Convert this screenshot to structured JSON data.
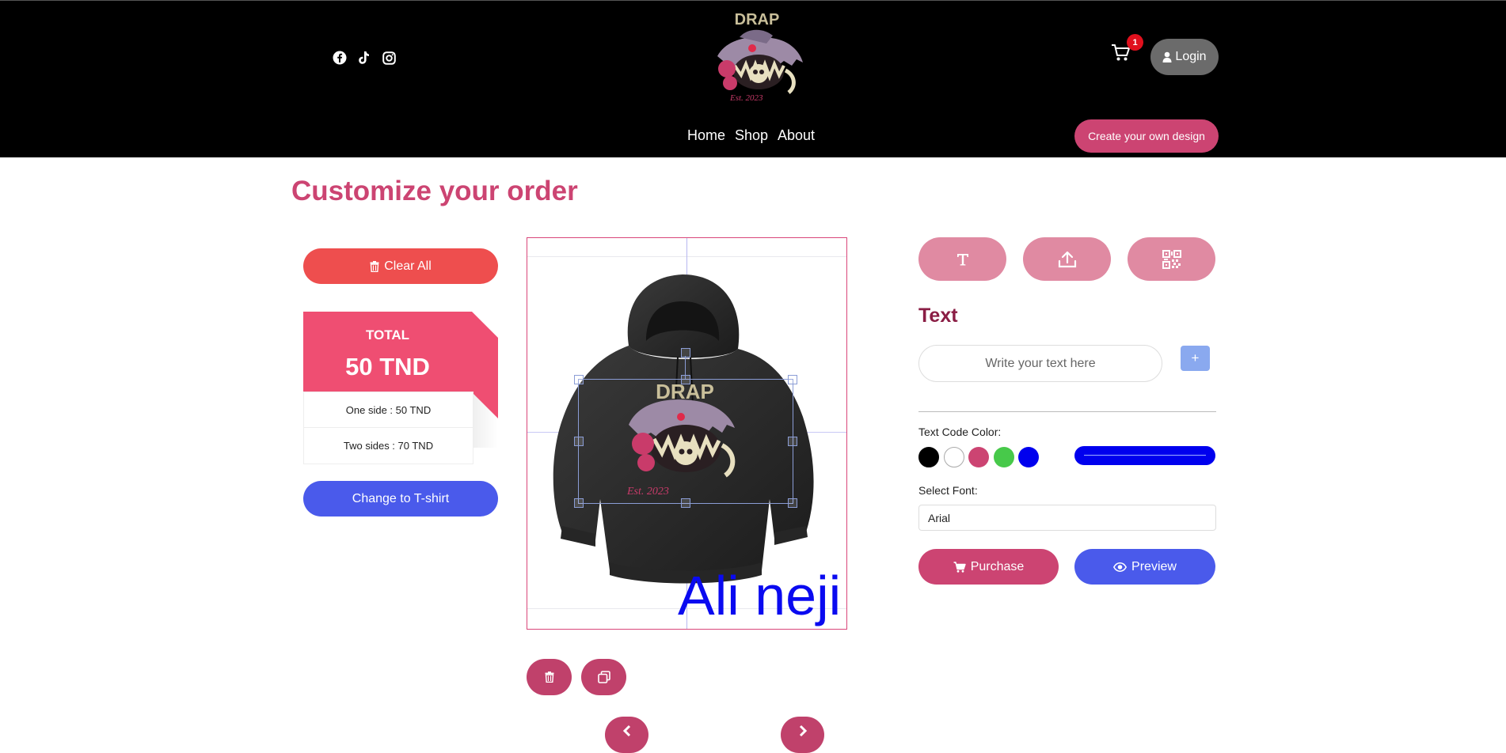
{
  "header": {
    "brand": "DRAP",
    "logo_tagline": "Est. 2023",
    "nav": [
      "Home",
      "Shop",
      "About"
    ],
    "cart_count": "1",
    "login_label": "Login",
    "create_label": "Create your own design",
    "social_icons": [
      "facebook-icon",
      "tiktok-icon",
      "instagram-icon"
    ]
  },
  "page": {
    "title": "Customize your order"
  },
  "left_panel": {
    "clear_label": "Clear All",
    "total_label": "TOTAL",
    "total_amount": "50 TND",
    "one_side": "One side : 50 TND",
    "two_sides": "Two sides : 70 TND",
    "change_label": "Change to T-shirt"
  },
  "canvas": {
    "product": "hoodie",
    "print_brand": "DRAP",
    "print_tagline": "Est. 2023",
    "custom_text": "Ali neji",
    "custom_text_color": "#0000ee"
  },
  "tools": [
    "text-tool-icon",
    "upload-icon",
    "qr-code-icon"
  ],
  "text_panel": {
    "title": "Text",
    "input_placeholder": "Write your text here",
    "add_label": "+",
    "color_label": "Text Code Color:",
    "swatches": [
      "#000000",
      "#ffffff",
      "#cc4472",
      "#47c94a",
      "#0000ee"
    ],
    "selected_color": "#0000ee",
    "font_label": "Select Font:",
    "font_value": "Arial",
    "purchase_label": "Purchase",
    "preview_label": "Preview"
  },
  "colors": {
    "accent": "#cc4472",
    "blue": "#4a5aeb",
    "red": "#ee4e4e",
    "price_pink": "#ef4e72"
  }
}
